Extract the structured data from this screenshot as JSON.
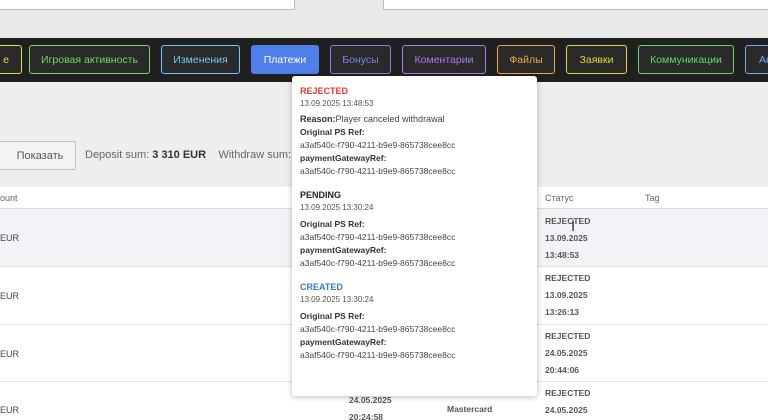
{
  "nav": {
    "buttons": [
      {
        "label": "е",
        "color": "#e0e040",
        "active": false
      },
      {
        "label": "Игровая активность",
        "color": "#6ddc5c",
        "active": false
      },
      {
        "label": "Изменения",
        "color": "#6fc7ff",
        "active": false
      },
      {
        "label": "Платежи",
        "color": "#4f7fe8",
        "active": true
      },
      {
        "label": "Бонусы",
        "color": "#7b84e8",
        "active": false
      },
      {
        "label": "Коментарии",
        "color": "#a77bf2",
        "active": false
      },
      {
        "label": "Файлы",
        "color": "#f0a64a",
        "active": false
      },
      {
        "label": "Заявки",
        "color": "#e5d635",
        "active": false
      },
      {
        "label": "Коммуникации",
        "color": "#62d86a",
        "active": false
      },
      {
        "label": "Ак",
        "color": "#6aa8ff",
        "active": false
      }
    ]
  },
  "filters": {
    "show_label": "Показать",
    "deposit_label": "Deposit sum:",
    "deposit_value": "3 310 EUR",
    "withdraw_label": "Withdraw sum:"
  },
  "table": {
    "headers": {
      "amount": "ount",
      "status": "Статус",
      "tag": "Tag"
    },
    "rows": [
      {
        "amount": "EUR",
        "status": [
          "REJECTED",
          "13.09.2025",
          "13:48:53"
        ]
      },
      {
        "amount": "EUR",
        "status": [
          "REJECTED",
          "13.09.2025",
          "13:26:13"
        ]
      },
      {
        "amount": "EUR",
        "status": [
          "REJECTED",
          "24.05.2025",
          "20:44:06"
        ]
      },
      {
        "amount": "EUR",
        "date": "24.05.2025",
        "time": "20:24:58",
        "method": "Mastercard",
        "status": [
          "REJECTED",
          "24.05.2025"
        ]
      }
    ]
  },
  "popup": {
    "entries": [
      {
        "status": "REJECTED",
        "status_color": "#e53935",
        "time": "13.09.2025 13:48:53",
        "reason_label": "Reason:",
        "reason_value": "Player canceled withdrawal",
        "ps_ref_label": "Original PS Ref:",
        "ps_ref_value": "a3af540c-f790-4211-b9e9-865738cee8cc",
        "gw_ref_label": "paymentGatewayRef:",
        "gw_ref_value": "a3af540c-f790-4211-b9e9-865738cee8cc"
      },
      {
        "status": "PENDING",
        "status_color": "#222222",
        "time": "13.09.2025 13:30:24",
        "ps_ref_label": "Original PS Ref:",
        "ps_ref_value": "a3af540c-f790-4211-b9e9-865738cee8cc",
        "gw_ref_label": "paymentGatewayRef:",
        "gw_ref_value": "a3af540c-f790-4211-b9e9-865738cee8cc"
      },
      {
        "status": "CREATED",
        "status_color": "#3a78d8",
        "time": "13.09.2025 13:30:24",
        "ps_ref_label": "Original PS Ref:",
        "ps_ref_value": "a3af540c-f790-4211-b9e9-865738cee8cc",
        "gw_ref_label": "paymentGatewayRef:",
        "gw_ref_value": "a3af540c-f790-4211-b9e9-865738cee8cc"
      }
    ]
  },
  "cursor": {
    "icon": "text-cursor-icon",
    "glyph": "I"
  }
}
